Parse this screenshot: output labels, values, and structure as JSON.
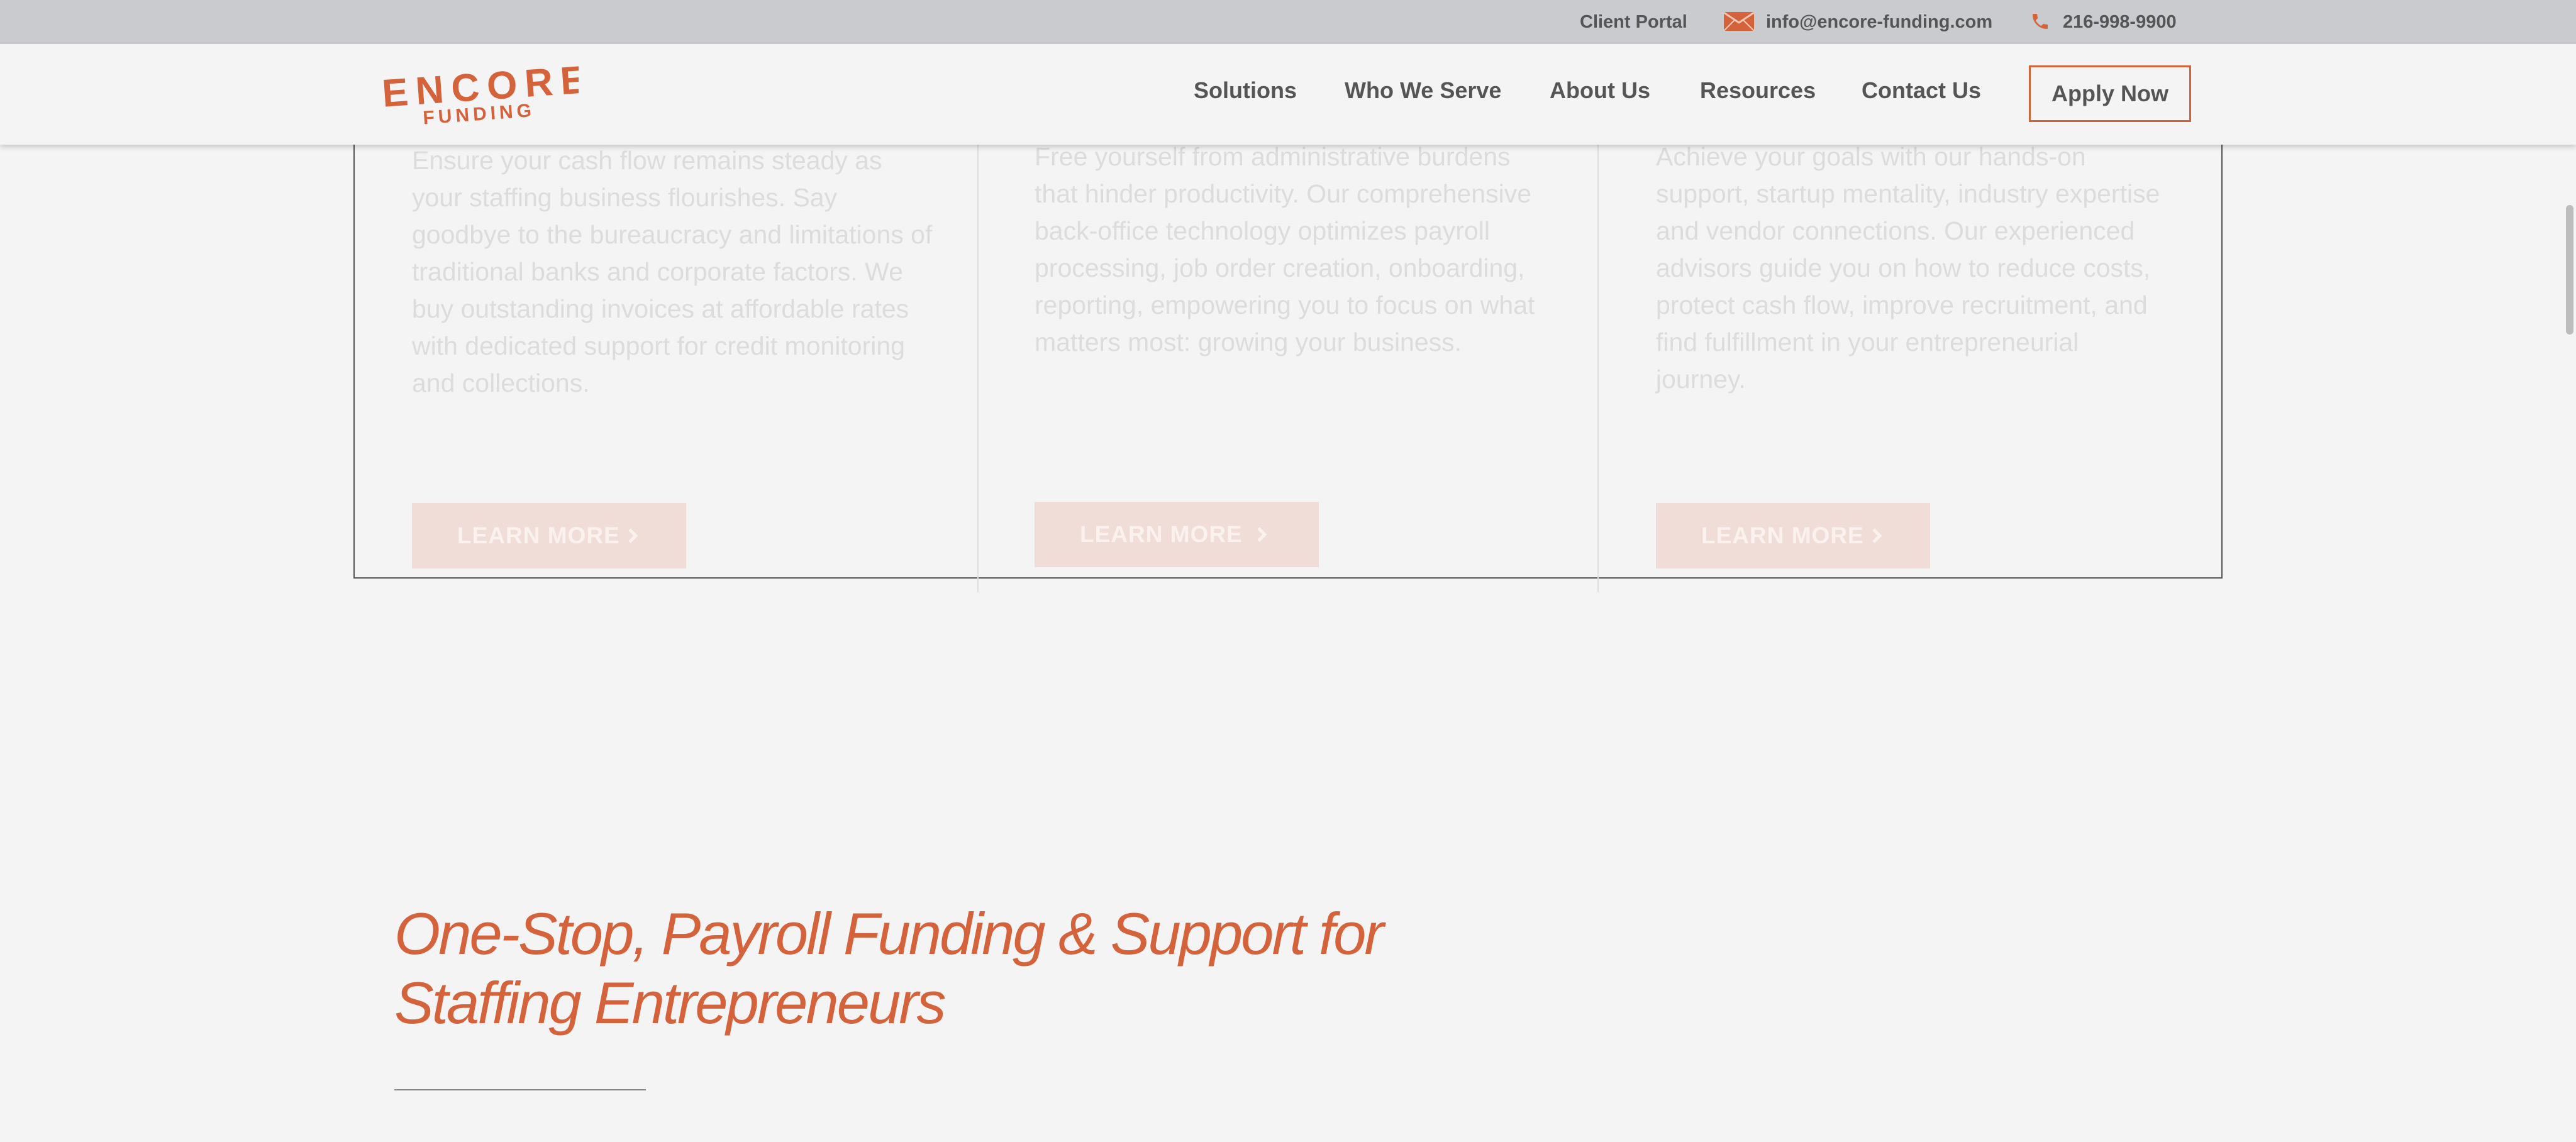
{
  "topbar": {
    "client_portal": "Client Portal",
    "email": "info@encore-funding.com",
    "phone": "216-998-9900",
    "icons": {
      "email": "envelope-icon",
      "phone": "phone-icon"
    }
  },
  "brand": {
    "line1": "ENCORE",
    "line2": "FUNDING",
    "accent": "#d4623a"
  },
  "nav": {
    "items": [
      "Solutions",
      "Who We Serve",
      "About Us",
      "Resources",
      "Contact Us"
    ],
    "cta": "Apply Now"
  },
  "cards": [
    {
      "text": "Ensure your cash flow remains steady as your staffing business flourishes. Say goodbye to the bureaucracy and limitations of traditional banks and corporate factors. We buy outstanding invoices at affordable rates with dedicated support for credit monitoring and collections.",
      "button": "LEARN MORE"
    },
    {
      "text": "Free yourself from administrative burdens that hinder productivity. Our comprehensive back-office technology optimizes payroll processing, job order creation, onboarding, reporting, empowering you to focus on what matters most: growing your business.",
      "button": "LEARN MORE"
    },
    {
      "text": "Achieve your goals with our hands-on support, startup mentality, industry expertise and vendor connections. Our experienced advisors guide you on how to reduce costs, protect cash flow, improve recruitment, and find fulfillment in your entrepreneurial journey.",
      "button": "LEARN MORE"
    }
  ],
  "section": {
    "headline_line1": "One-Stop, Payroll Funding & Support for",
    "headline_line2": "Staffing Entrepreneurs"
  }
}
